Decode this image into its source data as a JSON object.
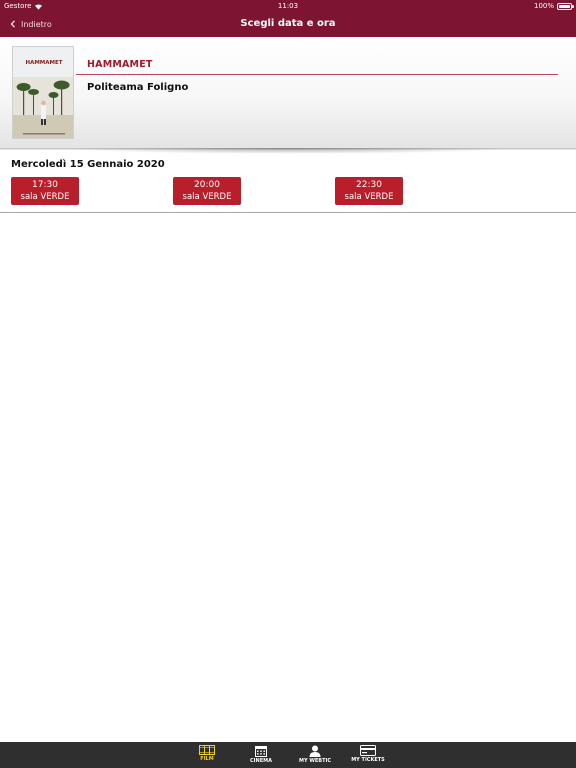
{
  "status_bar": {
    "carrier": "Gestore",
    "time": "11:03",
    "battery": "100%"
  },
  "nav": {
    "back_label": "Indietro",
    "title": "Scegli data e ora"
  },
  "film": {
    "title": "HAMMAMET",
    "cinema": "Politeama Foligno",
    "poster_title": "HAMMAMET"
  },
  "schedule": {
    "date": "Mercoledì 15 Gennaio 2020",
    "slots": [
      {
        "time": "17:30",
        "room": "sala VERDE"
      },
      {
        "time": "20:00",
        "room": "sala VERDE"
      },
      {
        "time": "22:30",
        "room": "sala VERDE"
      }
    ]
  },
  "tabs": [
    {
      "label": "FILM",
      "icon": "film-icon",
      "active": true
    },
    {
      "label": "CINEMA",
      "icon": "calendar-icon",
      "active": false
    },
    {
      "label": "MY WEBTIC",
      "icon": "user-icon",
      "active": false
    },
    {
      "label": "MY TICKETS",
      "icon": "ticket-icon",
      "active": false
    }
  ],
  "colors": {
    "nav_bg": "#7d1532",
    "accent": "#a3162b",
    "slot_bg": "#b91f2b",
    "tabbar_bg": "#2f2f2f",
    "tab_active": "#f2d21c"
  }
}
